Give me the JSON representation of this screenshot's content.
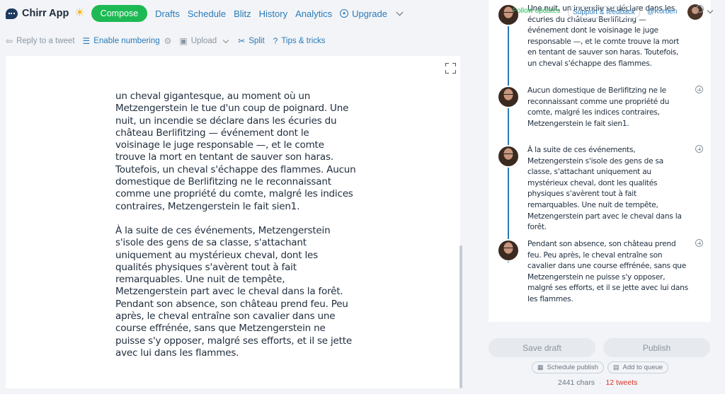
{
  "app": {
    "name": "Chirr App",
    "theme_icon": "sun-icon"
  },
  "nav": {
    "compose": "Compose",
    "links": [
      "Drafts",
      "Schedule",
      "Blitz",
      "History",
      "Analytics"
    ],
    "upgrade": "Upgrade"
  },
  "toolbar": {
    "reply": "Reply to a tweet",
    "numbering": "Enable numbering",
    "upload": "Upload",
    "split": "Split",
    "tips": "Tips & tricks"
  },
  "editor": {
    "paragraphs": [
      "un cheval gigantesque, au moment où un Metzengerstein le tue d'un coup de poignard. Une nuit, un incendie se déclare dans les écuries du château Berlifitzing — événement dont le voisinage le juge responsable —, et le comte trouve la mort en tentant de sauver son haras. Toutefois, un cheval s'échappe des flammes. Aucun domestique de Berlifitzing ne le reconnaissant comme une propriété du comte, malgré les indices contraires, Metzengerstein le fait sien1.",
      "À la suite de ces événements, Metzengerstein s'isole des gens de sa classe, s'attachant uniquement au mystérieux cheval, dont les qualités physiques s'avèrent tout à fait remarquables. Une nuit de tempête, Metzengerstein part avec le cheval dans la forêt. Pendant son absence, son château prend feu. Peu après, le cheval entraîne son cavalier dans une course effrénée, sans que Metzengerstein ne puisse s'y opposer, malgré ses efforts, et il se jette avec lui dans les flammes."
    ]
  },
  "header": {
    "follow": "Follow updates",
    "support": "Support & feedback",
    "handle": "@Korben"
  },
  "tweets": [
    "Une nuit, un incendie se déclare dans les écuries du château Berlifitzing — événement dont le voisinage le juge responsable —, et le comte trouve la mort en tentant de sauver son haras. Toutefois, un cheval s'échappe des flammes.",
    "Aucun domestique de Berlifitzing ne le reconnaissant comme une propriété du comte, malgré les indices contraires, Metzengerstein le fait sien1.",
    "À la suite de ces événements, Metzengerstein s'isole des gens de sa classe, s'attachant uniquement au mystérieux cheval, dont les qualités physiques s'avèrent tout à fait remarquables. Une nuit de tempête, Metzengerstein part avec le cheval dans la forêt.",
    "Pendant son absence, son château prend feu. Peu après, le cheval entraîne son cavalier dans une course effrénée, sans que Metzengerstein ne puisse s'y opposer, malgré ses efforts, et il se jette avec lui dans les flammes."
  ],
  "actions": {
    "save_draft": "Save draft",
    "publish": "Publish",
    "schedule": "Schedule publish",
    "queue": "Add to queue"
  },
  "status": {
    "chars": "2441 chars",
    "tweets": "12 tweets"
  },
  "colors": {
    "accent": "#1db954",
    "link": "#2a7ab8",
    "thread_line": "#2a7ab8",
    "warning": "#d9342b"
  }
}
